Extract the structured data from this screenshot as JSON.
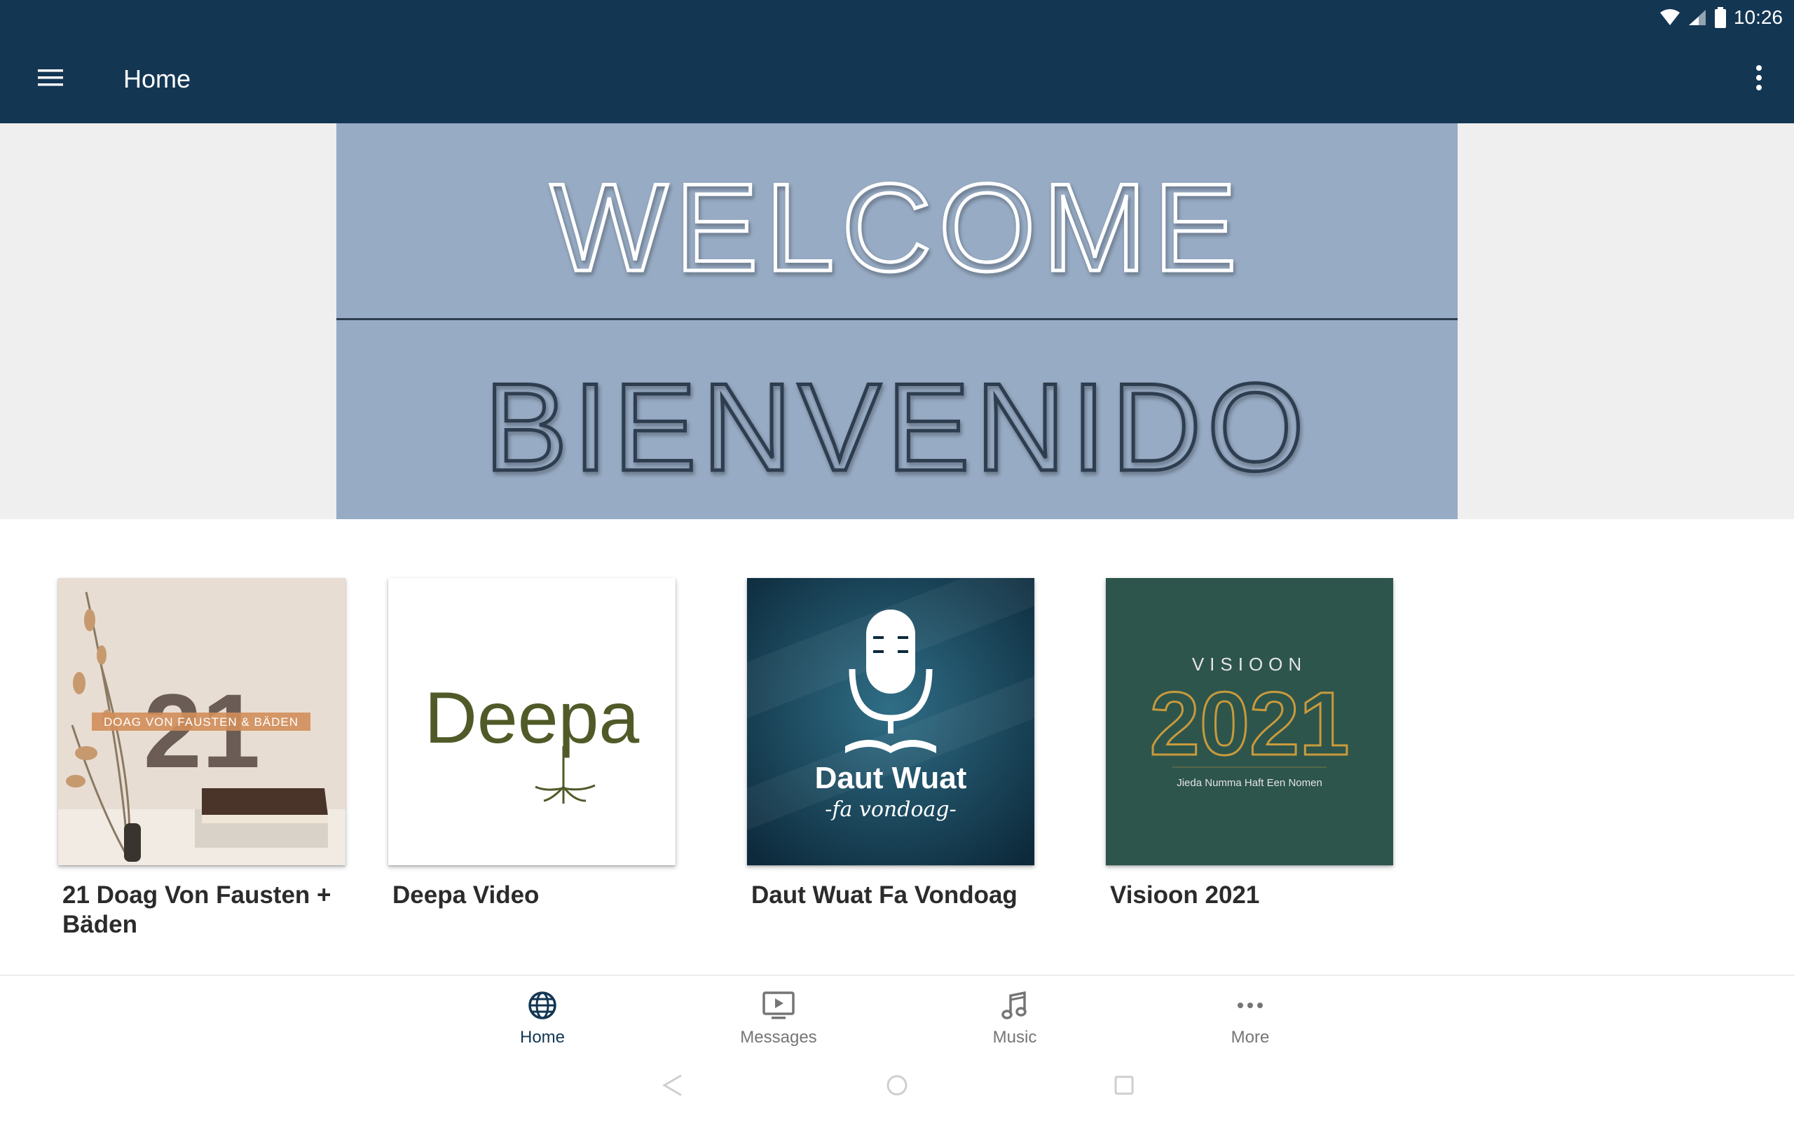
{
  "status_bar": {
    "time": "10:26",
    "icons": [
      "wifi-icon",
      "cell-signal-icon",
      "battery-icon"
    ]
  },
  "app_bar": {
    "title": "Home",
    "menu_icon": "hamburger-menu-icon",
    "overflow_icon": "more-vert-icon",
    "background": "#133653"
  },
  "banner": {
    "top_word": "WELCOME",
    "bottom_word": "BIENVENIDO",
    "background": "#97abc4"
  },
  "cards": [
    {
      "title": "21 Doag Von Fausten + Bäden",
      "thumb": {
        "number": "21",
        "caption": "DOAG VON FAUSTEN & BÄDEN"
      }
    },
    {
      "title": "Deepa Video",
      "thumb": {
        "wordmark": "Deepa"
      }
    },
    {
      "title": "Daut Wuat Fa Vondoag",
      "thumb": {
        "line1": "Daut Wuat",
        "line2": "-fa vondoag-",
        "icon": "microphone-icon"
      }
    },
    {
      "title": "Visioon 2021",
      "thumb": {
        "heading": "VISIOON",
        "year": "2021",
        "subtitle": "Jieda Numma Haft Een Nomen"
      }
    }
  ],
  "bottom_nav": {
    "items": [
      {
        "label": "Home",
        "icon": "globe-icon",
        "active": true
      },
      {
        "label": "Messages",
        "icon": "tv-play-icon",
        "active": false
      },
      {
        "label": "Music",
        "icon": "music-note-icon",
        "active": false
      },
      {
        "label": "More",
        "icon": "more-horiz-icon",
        "active": false
      }
    ],
    "active_color": "#133653",
    "inactive_color": "#757575"
  }
}
